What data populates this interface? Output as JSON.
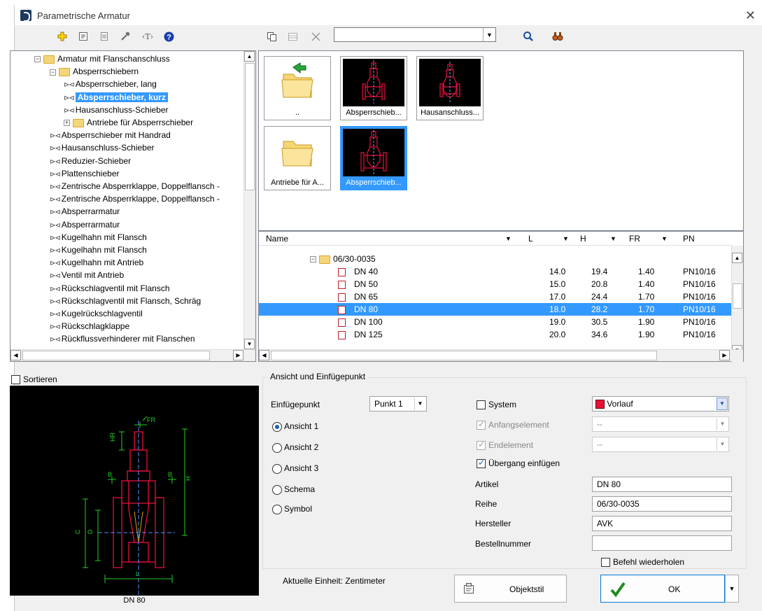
{
  "window": {
    "title": "Parametrische Armatur",
    "close": "✕"
  },
  "toolbar": {
    "icons": [
      "add-icon",
      "properties-icon",
      "document-icon",
      "tools-icon",
      "text-icon",
      "help-icon",
      "copy-icon",
      "table-icon",
      "delete-icon",
      "search-icon",
      "binoculars-icon"
    ],
    "search_value": "",
    "t_label": "‹T›"
  },
  "tree": {
    "items": [
      {
        "label": "Armatur mit Flanschanschluss",
        "level": 1,
        "type": "folder",
        "expanded": true
      },
      {
        "label": "Absperrschiebern",
        "level": 2,
        "type": "folder",
        "expanded": true
      },
      {
        "label": "Absperrschieber, lang",
        "level": 3,
        "type": "item"
      },
      {
        "label": "Absperrschieber, kurz",
        "level": 3,
        "type": "item",
        "selected": true
      },
      {
        "label": "Hausanschluss-Schieber",
        "level": 3,
        "type": "item"
      },
      {
        "label": "Antriebe für Absperrschieber",
        "level": 3,
        "type": "folder",
        "expanded": false
      },
      {
        "label": "Absperrschieber mit Handrad",
        "level": 2,
        "type": "item"
      },
      {
        "label": "Hausanschluss-Schieber",
        "level": 2,
        "type": "item"
      },
      {
        "label": "Reduzier-Schieber",
        "level": 2,
        "type": "item"
      },
      {
        "label": "Plattenschieber",
        "level": 2,
        "type": "item"
      },
      {
        "label": "Zentrische Absperrklappe, Doppelflansch -",
        "level": 2,
        "type": "item"
      },
      {
        "label": "Zentrische Absperrklappe, Doppelflansch -",
        "level": 2,
        "type": "item"
      },
      {
        "label": "Absperrarmatur",
        "level": 2,
        "type": "item"
      },
      {
        "label": "Absperrarmatur",
        "level": 2,
        "type": "item"
      },
      {
        "label": "Kugelhahn mit Flansch",
        "level": 2,
        "type": "item"
      },
      {
        "label": "Kugelhahn mit Flansch",
        "level": 2,
        "type": "item"
      },
      {
        "label": "Kugelhahn mit Antrieb",
        "level": 2,
        "type": "item"
      },
      {
        "label": "Ventil mit Antrieb",
        "level": 2,
        "type": "item"
      },
      {
        "label": "Rückschlagventil mit Flansch",
        "level": 2,
        "type": "item"
      },
      {
        "label": "Rückschlagventil mit Flansch, Schräg",
        "level": 2,
        "type": "item"
      },
      {
        "label": "Kugelrückschlagventil",
        "level": 2,
        "type": "item"
      },
      {
        "label": "Rückschlagklappe",
        "level": 2,
        "type": "item"
      },
      {
        "label": "Rückflussverhinderer mit Flanschen",
        "level": 2,
        "type": "item"
      }
    ]
  },
  "tiles": [
    {
      "caption": "..",
      "kind": "folder-up"
    },
    {
      "caption": "Absperrschieb...",
      "kind": "valve"
    },
    {
      "caption": "Hausanschluss...",
      "kind": "valve"
    },
    {
      "caption": "Antriebe für A...",
      "kind": "folder"
    },
    {
      "caption": "Absperrschieb...",
      "kind": "valve",
      "selected": true
    }
  ],
  "list": {
    "headers": {
      "name": "Name",
      "l": "L",
      "h": "H",
      "fr": "FR",
      "pn": "PN"
    },
    "group": "06/30-0035",
    "rows": [
      {
        "name": "DN 40",
        "l": "14.0",
        "h": "19.4",
        "fr": "1.40",
        "pn": "PN10/16"
      },
      {
        "name": "DN 50",
        "l": "15.0",
        "h": "20.8",
        "fr": "1.40",
        "pn": "PN10/16"
      },
      {
        "name": "DN 65",
        "l": "17.0",
        "h": "24.4",
        "fr": "1.70",
        "pn": "PN10/16"
      },
      {
        "name": "DN 80",
        "l": "18.0",
        "h": "28.2",
        "fr": "1.70",
        "pn": "PN10/16",
        "selected": true
      },
      {
        "name": "DN 100",
        "l": "19.0",
        "h": "30.5",
        "fr": "1.90",
        "pn": "PN10/16"
      },
      {
        "name": "DN 125",
        "l": "20.0",
        "h": "34.6",
        "fr": "1.90",
        "pn": "PN10/16"
      }
    ]
  },
  "sort_label": "Sortieren",
  "preview": {
    "caption": "DN 80",
    "labels": {
      "fr": "FR",
      "hr": "HR",
      "b1": "B",
      "b2": "B",
      "h": "H",
      "c": "C",
      "d": "D",
      "l": "L"
    }
  },
  "ansicht": {
    "title": "Ansicht und Einfügepunkt",
    "einfuegepunkt_label": "Einfügepunkt",
    "einfuegepunkt_value": "Punkt 1",
    "radios": [
      "Ansicht 1",
      "Ansicht 2",
      "Ansicht 3",
      "Schema",
      "Symbol"
    ],
    "system_label": "System",
    "system_value": "Vorlauf",
    "system_color": "#e8103c",
    "anfang_label": "Anfangselement",
    "anfang_value": "--",
    "ende_label": "Endelement",
    "ende_value": "--",
    "uebergang_label": "Übergang einfügen",
    "artikel_label": "Artikel",
    "artikel_value": "DN 80",
    "reihe_label": "Reihe",
    "reihe_value": "06/30-0035",
    "hersteller_label": "Hersteller",
    "hersteller_value": "AVK",
    "bestell_label": "Bestellnummer",
    "bestell_value": "",
    "wiederholen_label": "Befehl wiederholen"
  },
  "footer": {
    "einheit": "Aktuelle Einheit: Zentimeter",
    "objektstil": "Objektstil",
    "ok": "OK"
  }
}
